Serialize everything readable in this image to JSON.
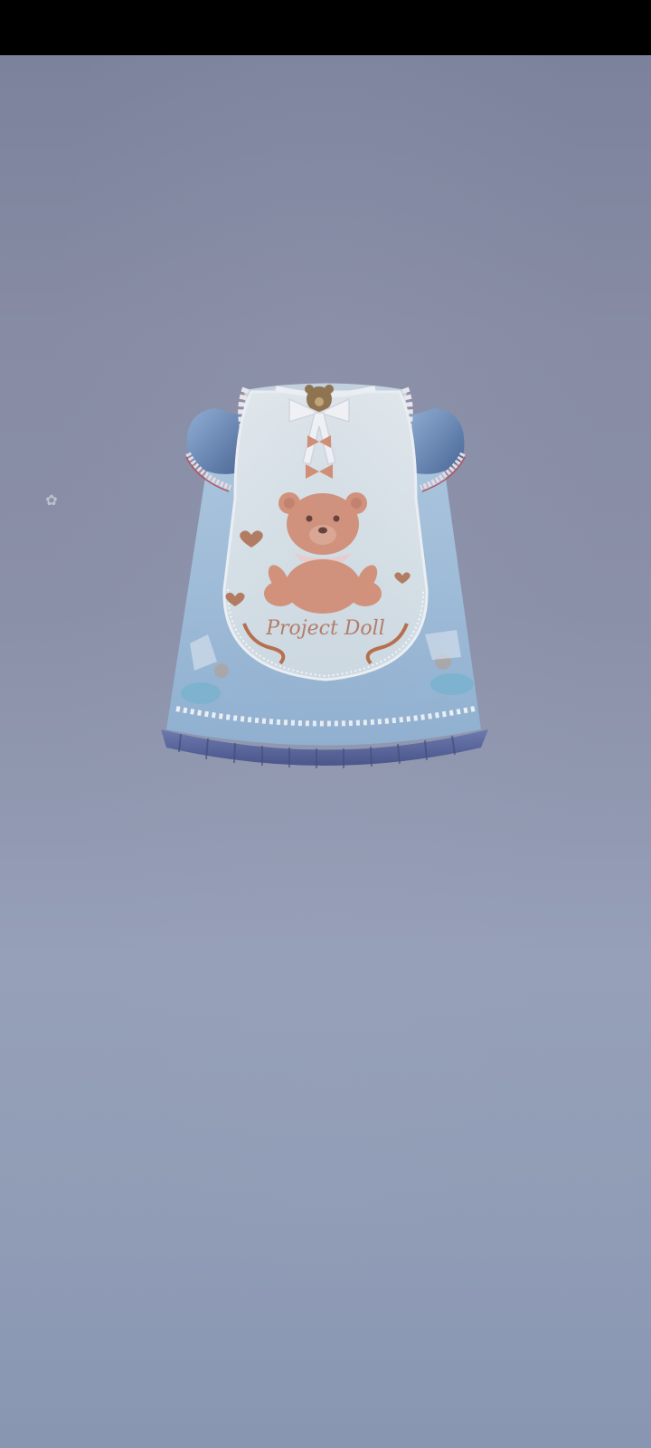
{
  "outfit": {
    "print_text": "Project Doll"
  },
  "colors": {
    "top_bar": "#000000",
    "background_top": "#7c829c",
    "background_bottom": "#8896b2",
    "dress_blue": "#5f7fb0",
    "apron": "#dbe6ea",
    "bear": "#d98e70",
    "skirt_hem": "#4f5f96"
  },
  "icons": {
    "sparkle": "sparkle-icon"
  }
}
